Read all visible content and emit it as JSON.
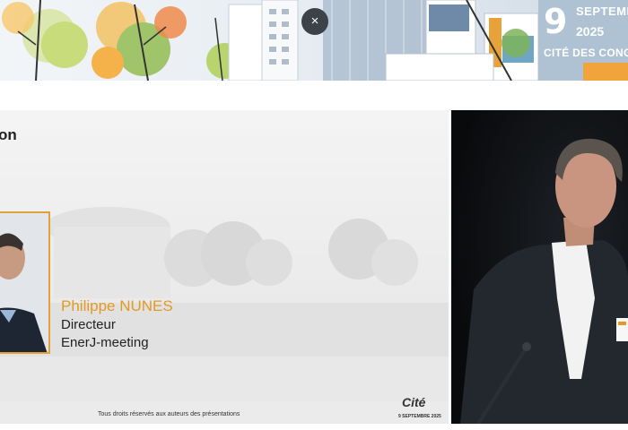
{
  "banner": {
    "day": "9",
    "month": "SEPTEMBRE",
    "year": "2025",
    "venue": "CITÉ DES CONGRÈS",
    "close_icon": "×",
    "accent": "#f0a43a"
  },
  "slide": {
    "title": "on",
    "speaker": {
      "name": "Philippe NUNES",
      "role": "Directeur",
      "organization": "EnerJ-meeting"
    },
    "footer_rights": "Tous droits réservés aux auteurs des présentations",
    "logo_word": "Cité",
    "logo_date": "9 SEPTEMBRE 2025",
    "name_color": "#e39a24",
    "frame_color": "#e1a03a"
  },
  "video": {
    "background": "#0d0f12"
  }
}
